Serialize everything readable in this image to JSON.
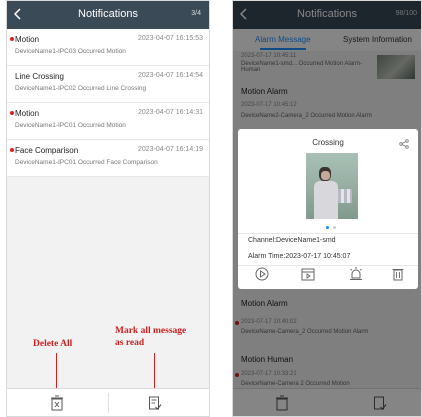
{
  "left": {
    "nav": {
      "back": "<",
      "title": "Notifications",
      "count": "3/4"
    },
    "notifications": [
      {
        "type": "Motion",
        "time": "2023-04-07 16:15:53",
        "desc": "DeviceName1-IPC03 Occurred Motion",
        "unread": true
      },
      {
        "type": "Line Crossing",
        "time": "2023-04-07 16:14:54",
        "desc": "DeviceName1-IPC02 Occurred Line Crossing",
        "unread": false
      },
      {
        "type": "Motion",
        "time": "2023-04-07 16:14:31",
        "desc": "DeviceName1-IPC01 Occurred Motion",
        "unread": true
      },
      {
        "type": "Face Comparison",
        "time": "2023-04-07 16:14:19",
        "desc": "DeviceName1-IPC01 Occurred Face Comparison",
        "unread": true
      }
    ],
    "annotations": {
      "delete_all": "Delete All",
      "mark_all_read_line1": "Mark all message",
      "mark_all_read_line2": "as read"
    },
    "toolbar": {
      "delete_icon": "trash-icon",
      "mark_read_icon": "mark-read-icon"
    }
  },
  "right": {
    "nav": {
      "back": "<",
      "title": "Notifications",
      "count": "98/100"
    },
    "tabs": {
      "alarm": "Alarm Message",
      "system": "System Information"
    },
    "background": [
      {
        "time": "2023-07-17 10:45:11",
        "desc": "DeviceName1-smd... Occurred Motion Alarm-Human"
      },
      {
        "type": "Motion Alarm",
        "time": "2023-07-17 10:45:12"
      },
      {
        "desc": "DeviceName2-Camera_2 Occurred Motion Alarm"
      },
      {
        "type": "Motion Alarm"
      },
      {
        "time": "2023-07-17 10:40:02",
        "desc": "DeviceName-Camera_2 Occurred Motion Alarm"
      },
      {
        "type": "Motion Human"
      },
      {
        "time": "2023-07-17 10:33:21",
        "desc": "DeviceName-Camera 2 Occurred Motion"
      }
    ],
    "dialog": {
      "title": "Crossing",
      "channel": "Channel:DeviceName1-smd",
      "alarm_time": "Alarm Time:2023-07-17 10:45:07",
      "actions": [
        "play-icon",
        "calendar-playback-icon",
        "light-alarm-icon",
        "trash-icon"
      ]
    }
  },
  "colors": {
    "nav": "#3b4a57",
    "accent": "#1e90ff",
    "unread": "#e02020",
    "annotation": "#cc2222"
  }
}
